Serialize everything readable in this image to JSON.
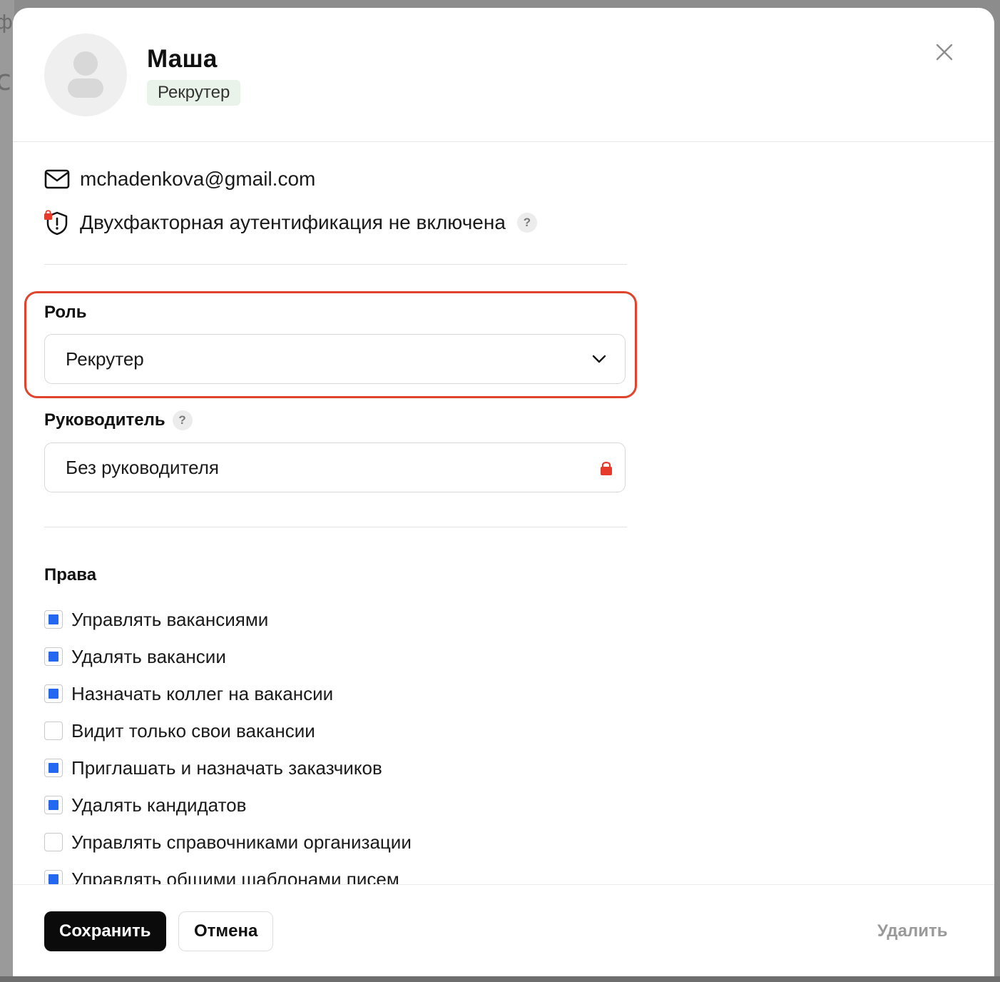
{
  "user": {
    "name": "Маша",
    "role_badge": "Рекрутер"
  },
  "contact": {
    "email": "mchadenkova@gmail.com"
  },
  "security": {
    "two_factor_text": "Двухфакторная аутентификация не включена",
    "help": "?"
  },
  "role_field": {
    "label": "Роль",
    "value": "Рекрутер"
  },
  "manager_field": {
    "label": "Руководитель",
    "help": "?",
    "value": "Без руководителя"
  },
  "permissions": {
    "title": "Права",
    "items": [
      {
        "label": "Управлять вакансиями",
        "checked": true
      },
      {
        "label": "Удалять вакансии",
        "checked": true
      },
      {
        "label": "Назначать коллег на вакансии",
        "checked": true
      },
      {
        "label": "Видит только свои вакансии",
        "checked": false
      },
      {
        "label": "Приглашать и назначать заказчиков",
        "checked": true
      },
      {
        "label": "Удалять кандидатов",
        "checked": true
      },
      {
        "label": "Управлять справочниками организации",
        "checked": false
      },
      {
        "label": "Управлять общими шаблонами писем",
        "checked": true
      }
    ]
  },
  "footer": {
    "save_label": "Сохранить",
    "cancel_label": "Отмена",
    "delete_label": "Удалить"
  },
  "colors": {
    "accent": "#2468f2",
    "highlight": "#e0442c",
    "lock": "#e53a2c",
    "badge_bg": "#eaf3ea"
  }
}
